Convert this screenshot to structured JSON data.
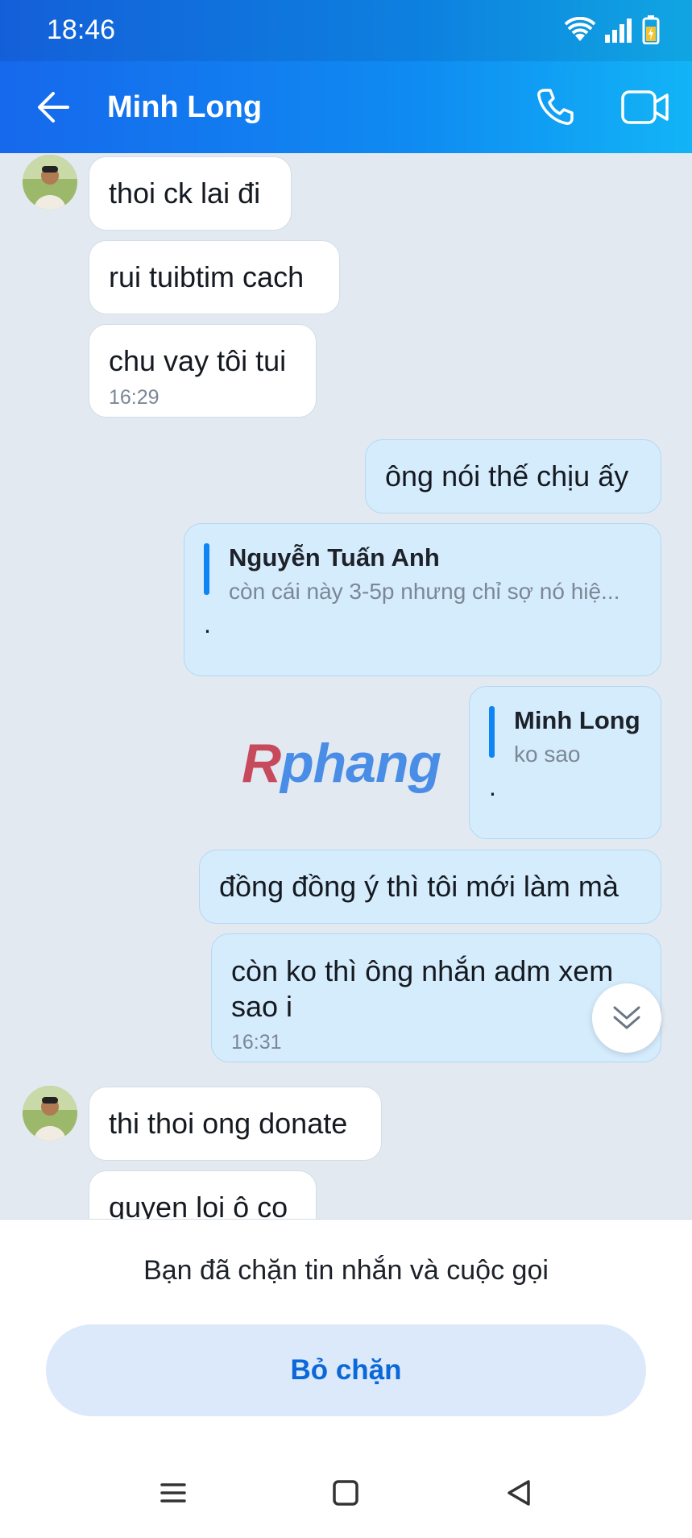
{
  "status": {
    "time": "18:46"
  },
  "header": {
    "title": "Minh Long"
  },
  "messages": {
    "m1": "thoi ck lai đi",
    "m2": "rui tuibtim cach",
    "m3": "chu vay tôi tui",
    "m3_time": "16:29",
    "m4": "ông nói thế chịu ấy",
    "m5_quote_name": "Nguyễn Tuấn Anh",
    "m5_quote_text": "còn cái này 3-5p nhưng chỉ sợ nó hiệ...",
    "m5_text": ".",
    "m6_quote_name": "Minh Long",
    "m6_quote_text": "ko sao",
    "m6_text": ".",
    "m7": "đồng đồng ý thì tôi mới làm mà",
    "m8": "còn ko thì ông nhắn adm xem sao i",
    "m8_time": "16:31",
    "m9": "thi thoi ong donate",
    "m10": "quyen loi ô co"
  },
  "watermark": {
    "first": "R",
    "rest": "phang"
  },
  "footer": {
    "blocked_text": "Bạn đã chặn tin nhắn và cuộc gọi",
    "unblock_label": "Bỏ chặn"
  },
  "colors": {
    "header_start": "#1668ec",
    "header_end": "#12b4f6",
    "chat_bg": "#e2e9f1",
    "incoming_bubble": "#ffffff",
    "outgoing_bubble": "#d5ecfd",
    "accent": "#0a68d8"
  },
  "icons": {
    "back": "arrow-left-icon",
    "call": "phone-icon",
    "video": "video-camera-icon",
    "scroll": "double-chevron-down-icon"
  }
}
